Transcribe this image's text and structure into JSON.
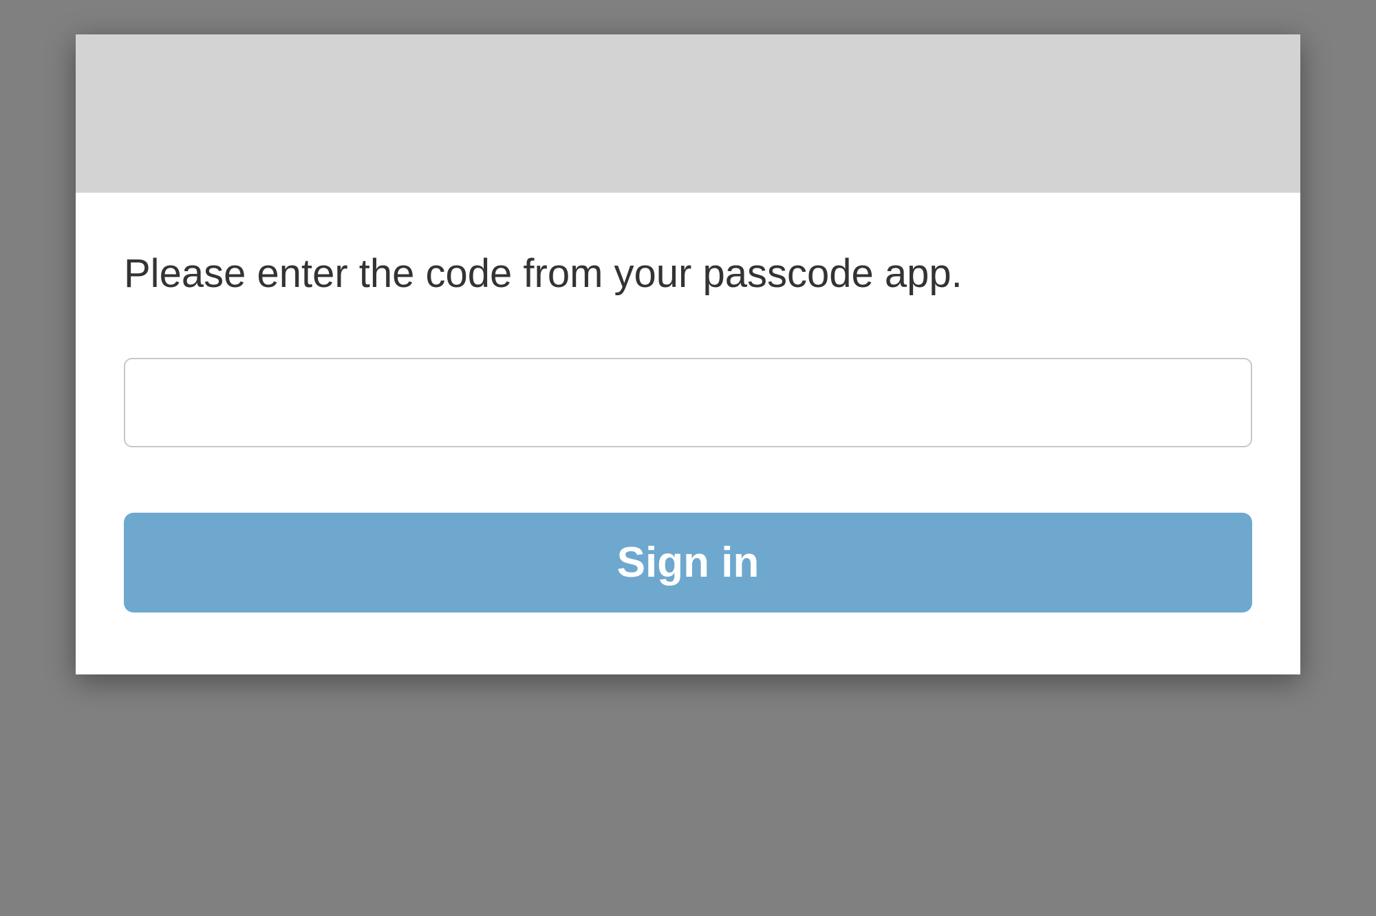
{
  "prompt": "Please enter the code from your passcode app.",
  "input": {
    "value": "",
    "placeholder": ""
  },
  "button": {
    "signin_label": "Sign in"
  }
}
